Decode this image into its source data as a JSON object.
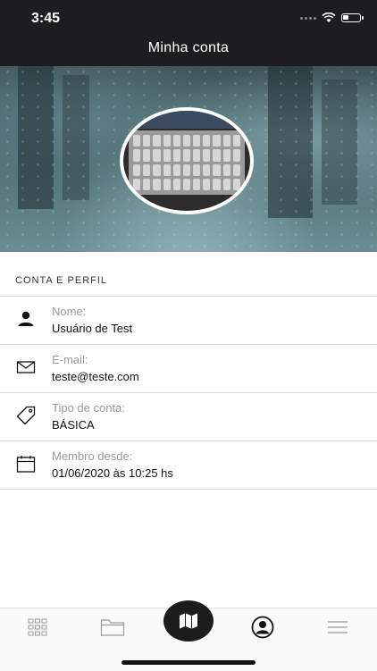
{
  "status_bar": {
    "time": "3:45"
  },
  "header": {
    "title": "Minha conta"
  },
  "section": {
    "title": "CONTA E PERFIL"
  },
  "profile_rows": [
    {
      "icon": "person-icon",
      "label": "Nome:",
      "value": "Usuário de Test"
    },
    {
      "icon": "envelope-icon",
      "label": "E-mail:",
      "value": "teste@teste.com"
    },
    {
      "icon": "tag-icon",
      "label": "Tipo de conta:",
      "value": "BÁSICA"
    },
    {
      "icon": "calendar-icon",
      "label": "Membro desde:",
      "value": "01/06/2020 às 10:25 hs"
    }
  ],
  "tab_bar": {
    "tabs": [
      "grid-icon",
      "folder-icon",
      "map-icon",
      "profile-icon",
      "menu-icon"
    ],
    "active": "profile-icon"
  },
  "colors": {
    "header_bg": "#1d1d1f",
    "accent": "#1c1c1c",
    "muted_text": "#9a9a9a"
  }
}
